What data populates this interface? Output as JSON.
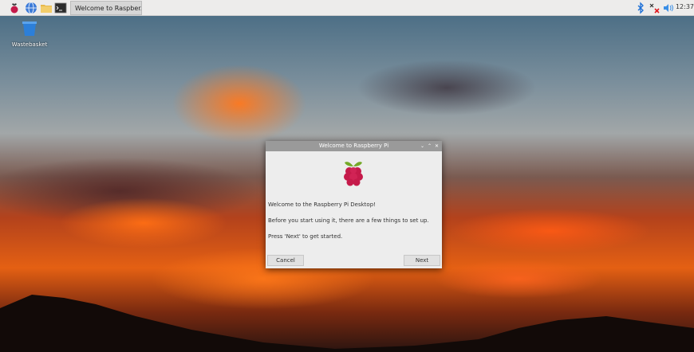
{
  "taskbar": {
    "icons": [
      "raspberry-menu-icon",
      "web-browser-icon",
      "file-manager-icon",
      "terminal-icon"
    ],
    "task_button_label": "Welcome to Raspber...",
    "tray_icons": [
      "bluetooth-icon",
      "network-disconnected-icon",
      "volume-icon"
    ],
    "clock": "12:37"
  },
  "desktop": {
    "icons": [
      {
        "label": "Wastebasket"
      }
    ]
  },
  "dialog": {
    "title": "Welcome to Raspberry Pi",
    "messages": [
      "Welcome to the Raspberry Pi Desktop!",
      "Before you start using it, there are a few things to set up.",
      "Press 'Next' to get started."
    ],
    "cancel_label": "Cancel",
    "next_label": "Next"
  },
  "colors": {
    "raspberry": "#c51a4a",
    "leaf": "#75a928",
    "panel": "#edeceb",
    "titlebar": "#9a9a9a"
  }
}
